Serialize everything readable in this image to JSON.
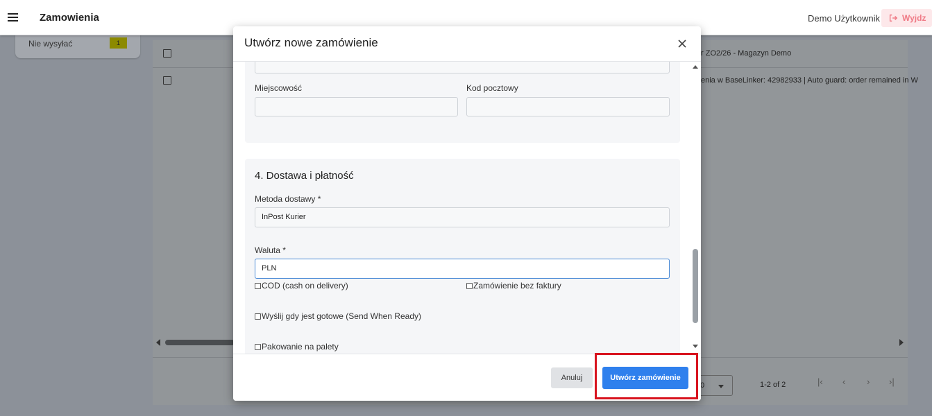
{
  "app": {
    "title": "Zamowienia",
    "user_name": "Demo Użytkownik",
    "logout_label": "Wyjdz"
  },
  "background": {
    "sidebar_item": {
      "label": "Nie wysyłać",
      "badge": "1"
    },
    "table_rows": [
      {
        "text": "r ZO2/26 - Magazyn Demo"
      },
      {
        "text": "enia w BaseLinker: 42982933 | Auto guard: order remained in W"
      }
    ],
    "pagination": {
      "per_page": "0",
      "range": "1-2 of 2"
    }
  },
  "modal": {
    "title": "Utwórz nowe zamówienie",
    "address": {
      "city_label": "Miejscowość",
      "city_value": "",
      "postal_label": "Kod pocztowy",
      "postal_value": ""
    },
    "delivery": {
      "heading": "4. Dostawa i płatność",
      "method_label": "Metoda dostawy *",
      "method_value": "InPost Kurier",
      "currency_label": "Waluta *",
      "currency_value": "PLN",
      "checkboxes": {
        "cod": "COD (cash on delivery)",
        "no_invoice": "Zamówienie bez faktury",
        "send_when_ready": "Wyślij gdy jest gotowe (Send When Ready)",
        "pallets": "Pakowanie na palety"
      }
    },
    "buttons": {
      "cancel": "Anuluj",
      "create": "Utwórz zamówienie"
    }
  },
  "colors": {
    "primary": "#2f80ed",
    "logout": "#f07a86",
    "highlight": "#d8141f"
  }
}
